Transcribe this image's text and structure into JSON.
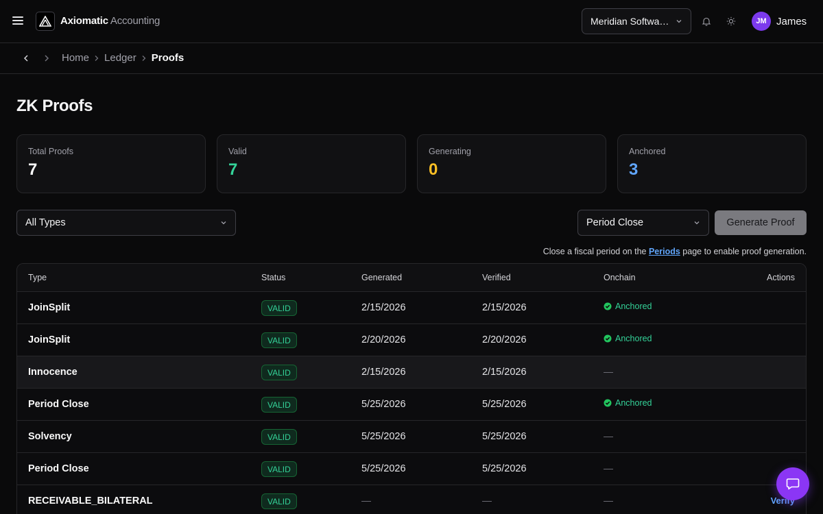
{
  "app": {
    "brand_primary": "Axiomatic",
    "brand_secondary": "Accounting"
  },
  "header": {
    "org_selected": "Meridian Software Inc.",
    "user": {
      "initials": "JM",
      "name": "James"
    },
    "icons": [
      "menu-icon",
      "bell-icon",
      "sun-icon"
    ]
  },
  "breadcrumb": {
    "items": [
      "Home",
      "Ledger",
      "Proofs"
    ]
  },
  "page": {
    "title": "ZK Proofs"
  },
  "stats": [
    {
      "label": "Total Proofs",
      "value": "7",
      "color": "#fafafa"
    },
    {
      "label": "Valid",
      "value": "7",
      "color": "#34d399"
    },
    {
      "label": "Generating",
      "value": "0",
      "color": "#fbbf24"
    },
    {
      "label": "Anchored",
      "value": "3",
      "color": "#60a5fa"
    }
  ],
  "filters": {
    "type_filter": "All Types",
    "proof_type": "Period Close",
    "generate_label": "Generate Proof",
    "hint_prefix": "Close a fiscal period on the",
    "hint_link": "Periods",
    "hint_suffix": "page to enable proof generation."
  },
  "table": {
    "columns": [
      "Type",
      "Status",
      "Generated",
      "Verified",
      "Onchain",
      "Actions"
    ],
    "rows": [
      {
        "type": "JoinSplit",
        "status": "VALID",
        "generated": "2/15/2026",
        "verified": "2/15/2026",
        "onchain": "Anchored",
        "action": ""
      },
      {
        "type": "JoinSplit",
        "status": "VALID",
        "generated": "2/20/2026",
        "verified": "2/20/2026",
        "onchain": "Anchored",
        "action": ""
      },
      {
        "type": "Innocence",
        "status": "VALID",
        "generated": "2/15/2026",
        "verified": "2/15/2026",
        "onchain": "—",
        "action": ""
      },
      {
        "type": "Period Close",
        "status": "VALID",
        "generated": "5/25/2026",
        "verified": "5/25/2026",
        "onchain": "Anchored",
        "action": ""
      },
      {
        "type": "Solvency",
        "status": "VALID",
        "generated": "5/25/2026",
        "verified": "5/25/2026",
        "onchain": "—",
        "action": ""
      },
      {
        "type": "Period Close",
        "status": "VALID",
        "generated": "5/25/2026",
        "verified": "5/25/2026",
        "onchain": "—",
        "action": ""
      },
      {
        "type": "RECEIVABLE_BILATERAL",
        "status": "VALID",
        "generated": "—",
        "verified": "—",
        "onchain": "—",
        "action": "Verify"
      }
    ]
  },
  "colors": {
    "accent": "#7c3aed",
    "success": "#34d399",
    "warning": "#fbbf24",
    "info": "#60a5fa"
  }
}
